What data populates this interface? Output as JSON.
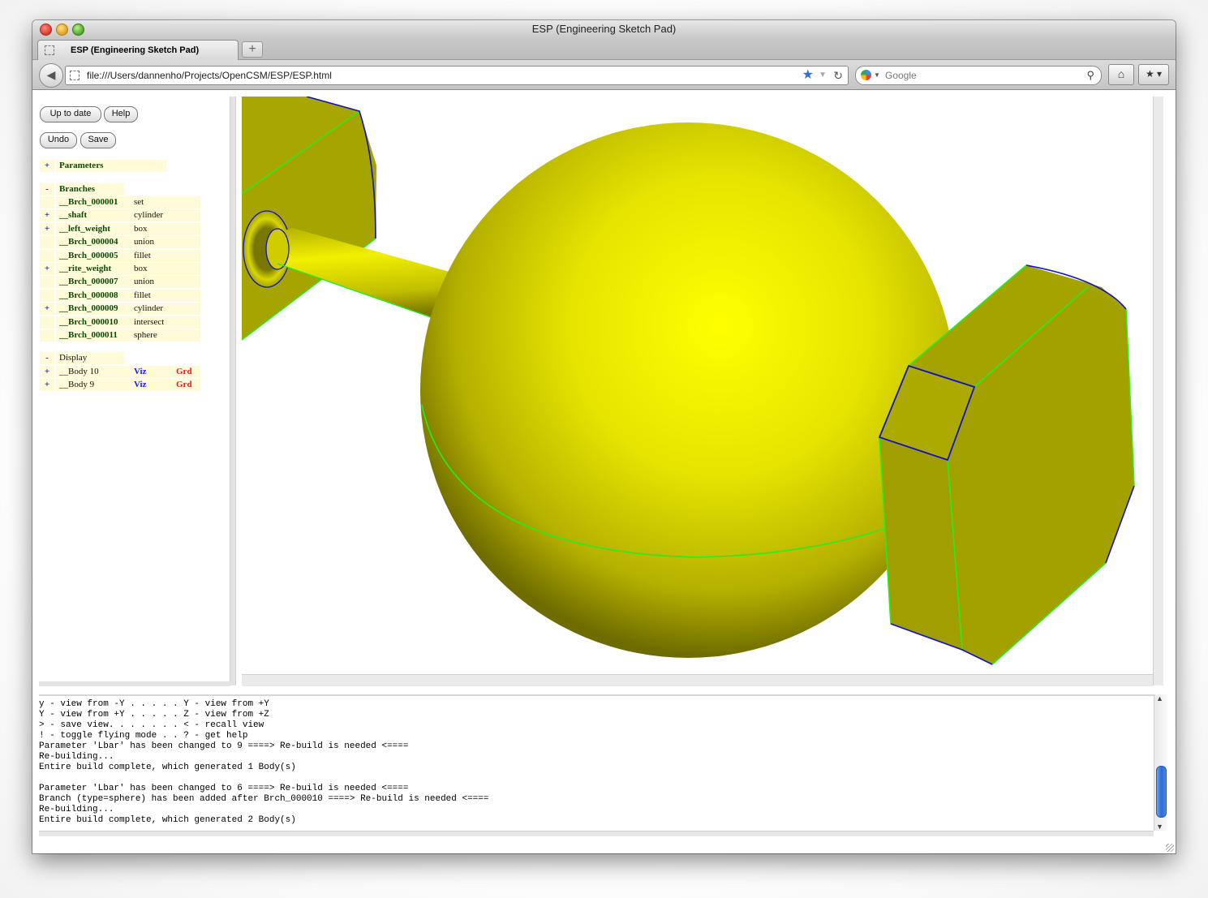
{
  "window": {
    "title": "ESP (Engineering Sketch Pad)"
  },
  "tabs": [
    {
      "label": "ESP (Engineering Sketch Pad)"
    }
  ],
  "toolbar": {
    "new_tab_label": "+",
    "url": "file:///Users/dannenho/Projects/OpenCSM/ESP/ESP.html",
    "search_placeholder": "Google"
  },
  "buttons": {
    "up_to_date": "Up to date",
    "help": "Help",
    "undo": "Undo",
    "save": "Save"
  },
  "tree": {
    "parameters": {
      "toggle": "+",
      "label": "Parameters"
    },
    "branches": {
      "toggle": "-",
      "label": "Branches",
      "items": [
        {
          "toggle": "",
          "name": "__Brch_000001",
          "type": "set"
        },
        {
          "toggle": "+",
          "name": "__shaft",
          "type": "cylinder"
        },
        {
          "toggle": "+",
          "name": "__left_weight",
          "type": "box"
        },
        {
          "toggle": "",
          "name": "__Brch_000004",
          "type": "union"
        },
        {
          "toggle": "",
          "name": "__Brch_000005",
          "type": "fillet"
        },
        {
          "toggle": "+",
          "name": "__rite_weight",
          "type": "box"
        },
        {
          "toggle": "",
          "name": "__Brch_000007",
          "type": "union"
        },
        {
          "toggle": "",
          "name": "__Brch_000008",
          "type": "fillet"
        },
        {
          "toggle": "+",
          "name": "__Brch_000009",
          "type": "cylinder"
        },
        {
          "toggle": "",
          "name": "__Brch_000010",
          "type": "intersect"
        },
        {
          "toggle": "",
          "name": "__Brch_000011",
          "type": "sphere"
        }
      ]
    },
    "display": {
      "toggle": "-",
      "label": "Display",
      "items": [
        {
          "toggle": "+",
          "name": "__Body 10",
          "viz": "Viz",
          "grd": "Grd"
        },
        {
          "toggle": "+",
          "name": "__Body 9",
          "viz": "Viz",
          "grd": "Grd"
        }
      ]
    }
  },
  "console": {
    "lines": [
      "y - view from -Y . . . . . Y - view from +Y",
      "Y - view from +Y . . . . . Z - view from +Z",
      "> - save view. . . . . . . < - recall view",
      "! - toggle flying mode . . ? - get help",
      "Parameter 'Lbar' has been changed to 9 ====> Re-build is needed <====",
      "Re-building...",
      "Entire build complete, which generated 1 Body(s)",
      "",
      "Parameter 'Lbar' has been changed to 6 ====> Re-build is needed <====",
      "Branch (type=sphere) has been added after Brch_000010 ====> Re-build is needed <====",
      "Re-building...",
      "Entire build complete, which generated 2 Body(s)"
    ]
  },
  "colors": {
    "sphere": "#f2f200",
    "weight_face": "#a8a600",
    "edge_green": "#22ee22",
    "edge_blue": "#1010cc",
    "viz": "#1a1aff",
    "grd": "#e02020"
  },
  "icons": [
    "back-arrow-icon",
    "page-icon",
    "bookmark-star-icon",
    "reload-icon",
    "google-icon",
    "search-icon",
    "home-icon",
    "bookmarks-menu-icon"
  ]
}
